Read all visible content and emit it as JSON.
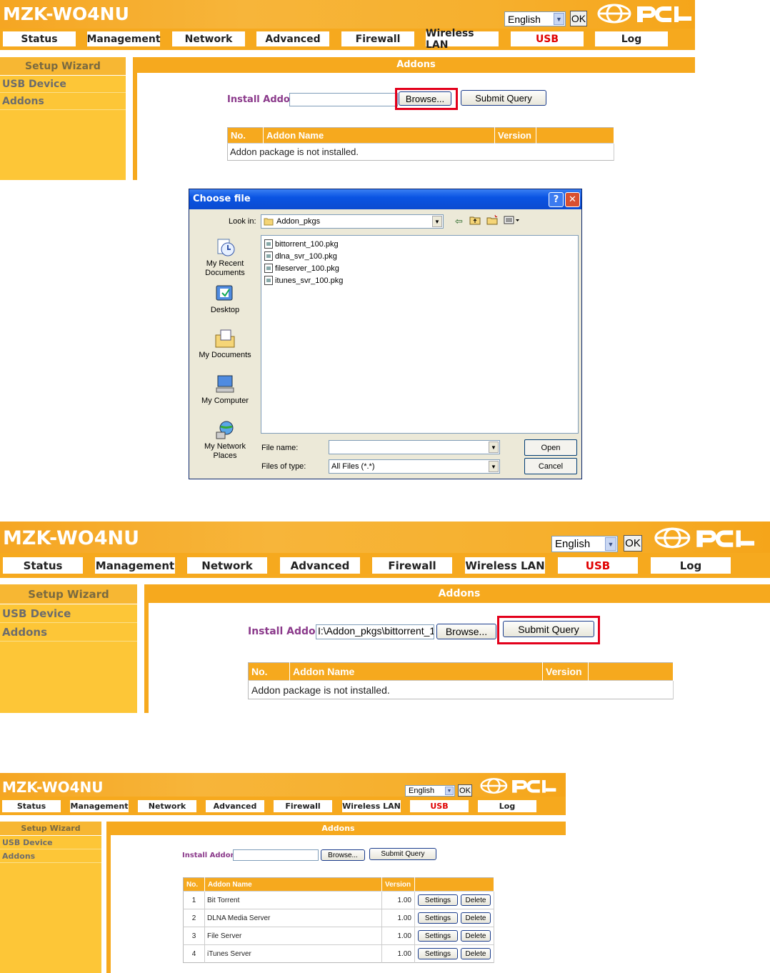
{
  "app": {
    "brand": "MZK-WO4NU",
    "language": "English",
    "ok_label": "OK",
    "logo_text": "PCi"
  },
  "nav": [
    "Status",
    "Management",
    "Network",
    "Advanced",
    "Firewall",
    "Wireless LAN",
    "USB",
    "Log"
  ],
  "sidebar": {
    "title": "Setup Wizard",
    "items": [
      "USB Device",
      "Addons"
    ]
  },
  "addons": {
    "title": "Addons",
    "install_label": "Install Addon",
    "browse_label": "Browse...",
    "submit_label": "Submit Query",
    "selected_file": "I:\\Addon_pkgs\\bittorrent_1",
    "columns": [
      "No.",
      "Addon Name",
      "Version"
    ],
    "empty_message": "Addon package is not installed.",
    "installed": [
      {
        "no": "1",
        "name": "Bit Torrent",
        "version": "1.00"
      },
      {
        "no": "2",
        "name": "DLNA Media Server",
        "version": "1.00"
      },
      {
        "no": "3",
        "name": "File Server",
        "version": "1.00"
      },
      {
        "no": "4",
        "name": "iTunes Server",
        "version": "1.00"
      }
    ],
    "settings_label": "Settings",
    "delete_label": "Delete"
  },
  "dialog": {
    "title": "Choose file",
    "help": "?",
    "look_in_label": "Look in:",
    "look_in_value": "Addon_pkgs",
    "places": [
      "My Recent Documents",
      "Desktop",
      "My Documents",
      "My Computer",
      "My Network Places"
    ],
    "files": [
      "bittorrent_100.pkg",
      "dlna_svr_100.pkg",
      "fileserver_100.pkg",
      "itunes_svr_100.pkg"
    ],
    "file_name_label": "File name:",
    "file_name_value": "",
    "file_type_label": "Files of type:",
    "file_type_value": "All Files (*.*)",
    "open_label": "Open",
    "cancel_label": "Cancel"
  }
}
